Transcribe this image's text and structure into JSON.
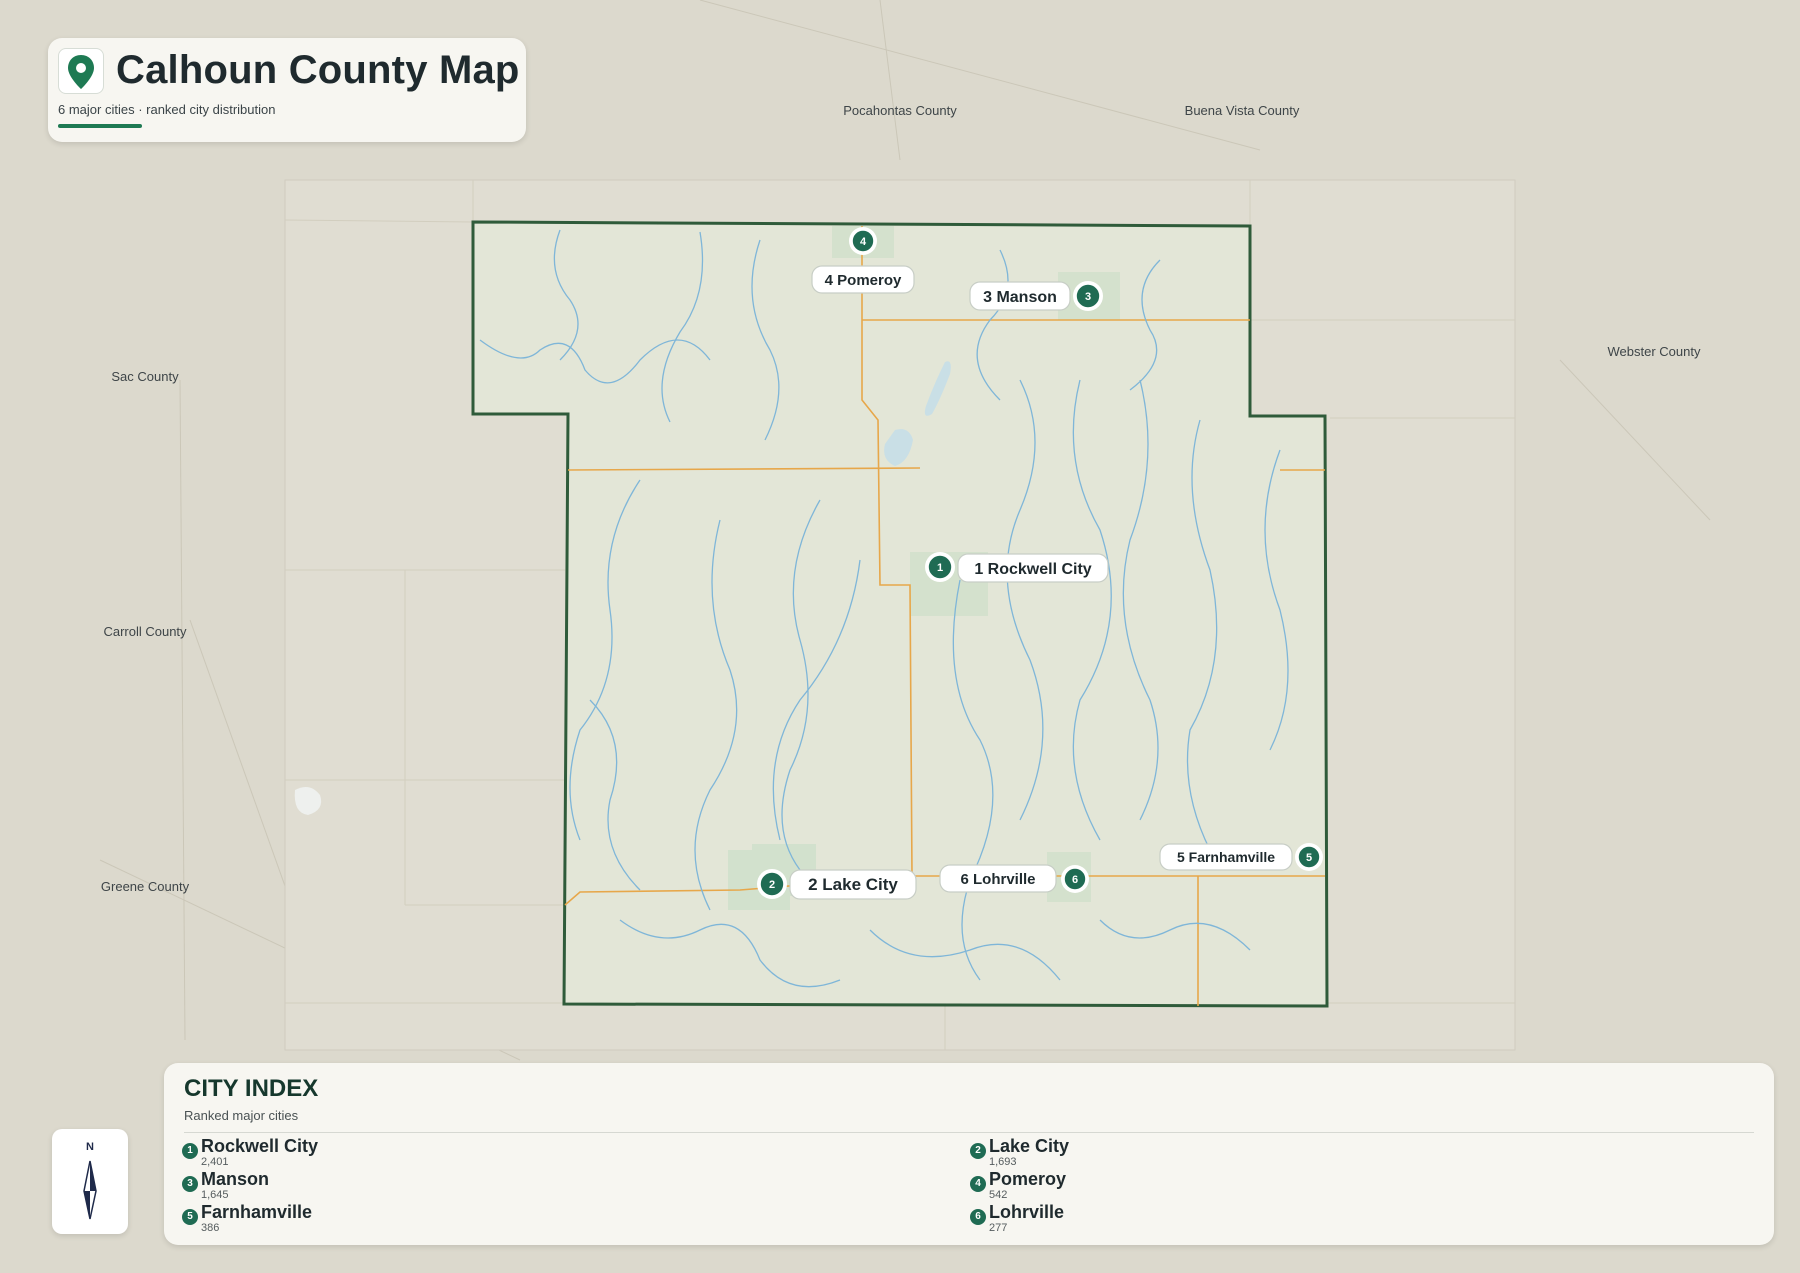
{
  "header": {
    "title": "Calhoun County Map",
    "subtitle": "6 major cities · ranked city distribution"
  },
  "map": {
    "neighbor_counties": [
      {
        "name": "Pocahontas County"
      },
      {
        "name": "Buena Vista County"
      },
      {
        "name": "Sac County"
      },
      {
        "name": "Webster County"
      },
      {
        "name": "Carroll County"
      },
      {
        "name": "Greene County"
      }
    ],
    "cities": [
      {
        "rank": "1",
        "label": "1 Rockwell City"
      },
      {
        "rank": "2",
        "label": "2 Lake City"
      },
      {
        "rank": "3",
        "label": "3 Manson"
      },
      {
        "rank": "4",
        "label": "4 Pomeroy"
      },
      {
        "rank": "5",
        "label": "5 Farnhamville"
      },
      {
        "rank": "6",
        "label": "6 Lohrville"
      }
    ],
    "colors": {
      "county_border": "#2f5b3a",
      "county_fill": "#e3e6d7",
      "river": "#7fb6d8",
      "road": "#e7a74a",
      "marker": "#1f6b53",
      "background": "#dcd9cd"
    }
  },
  "compass": {
    "north": "N"
  },
  "index": {
    "title": "CITY INDEX",
    "subtitle": "Ranked major cities",
    "items": [
      {
        "rank": "1",
        "name": "Rockwell City",
        "population": "2,401"
      },
      {
        "rank": "2",
        "name": "Lake City",
        "population": "1,693"
      },
      {
        "rank": "3",
        "name": "Manson",
        "population": "1,645"
      },
      {
        "rank": "4",
        "name": "Pomeroy",
        "population": "542"
      },
      {
        "rank": "5",
        "name": "Farnhamville",
        "population": "386"
      },
      {
        "rank": "6",
        "name": "Lohrville",
        "population": "277"
      }
    ]
  }
}
